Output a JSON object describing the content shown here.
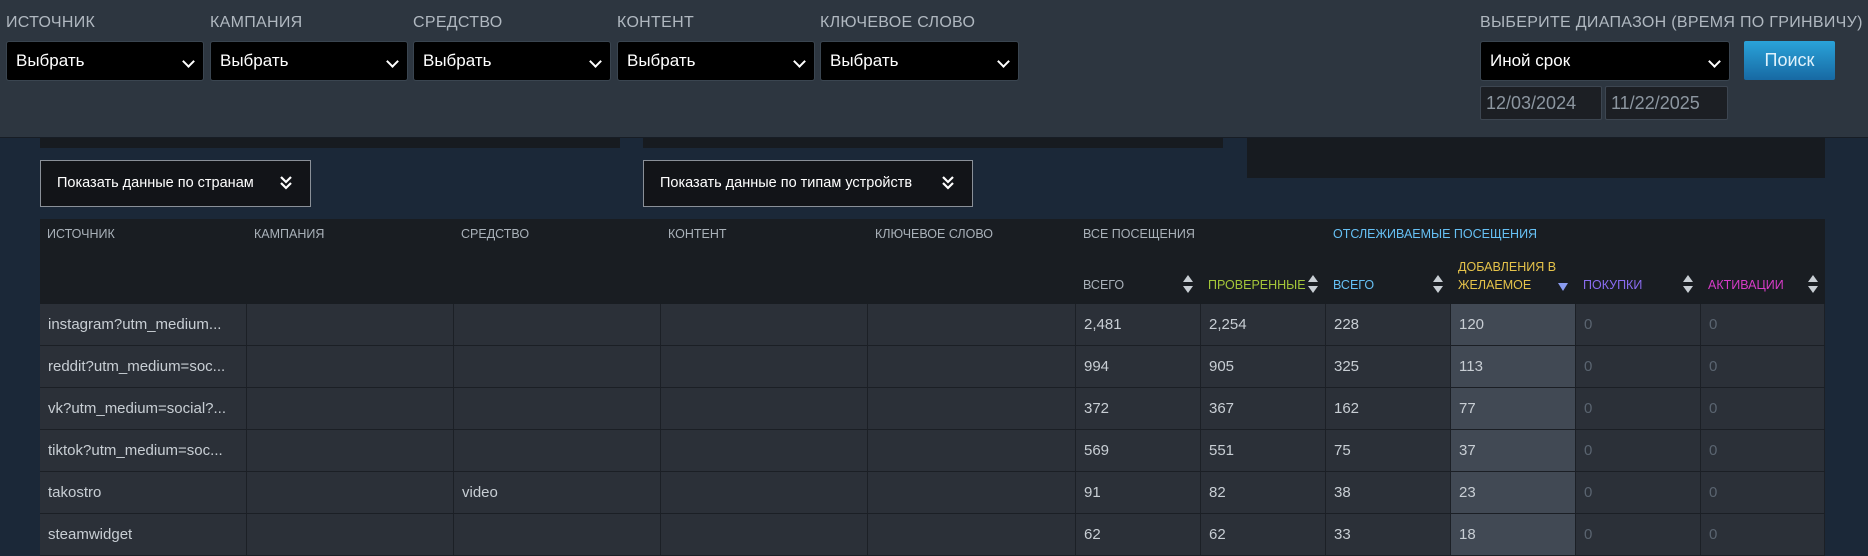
{
  "filters": [
    {
      "label": "ИСТОЧНИК",
      "value": "Выбрать"
    },
    {
      "label": "КАМПАНИЯ",
      "value": "Выбрать"
    },
    {
      "label": "СРЕДСТВО",
      "value": "Выбрать"
    },
    {
      "label": "КОНТЕНТ",
      "value": "Выбрать"
    },
    {
      "label": "КЛЮЧЕВОЕ СЛОВО",
      "value": "Выбрать"
    }
  ],
  "range": {
    "label": "ВЫБЕРИТЕ ДИАПАЗОН (ВРЕМЯ ПО ГРИНВИЧУ)",
    "value": "Иной срок",
    "start_date": "12/03/2024",
    "end_date": "11/22/2025",
    "search_label": "Поиск"
  },
  "toggles": {
    "countries": "Показать данные по странам",
    "devices": "Показать данные по типам устройств"
  },
  "table": {
    "headers": {
      "source": "ИСТОЧНИК",
      "campaign": "КАМПАНИЯ",
      "medium": "СРЕДСТВО",
      "content": "КОНТЕНТ",
      "keyword": "КЛЮЧЕВОЕ СЛОВО",
      "all_visits": "ВСЕ ПОСЕЩЕНИЯ",
      "tracked_visits": "ОТСЛЕЖИВАЕМЫЕ ПОСЕЩЕНИЯ",
      "total": "ВСЕГО",
      "verified": "ПРОВЕРЕННЫЕ",
      "tracked_total": "ВСЕГО",
      "wishlist_line1": "ДОБАВЛЕНИЯ В",
      "wishlist_line2": "ЖЕЛАЕМОЕ",
      "purchases": "ПОКУПКИ",
      "activations": "АКТИВАЦИИ"
    },
    "colors": {
      "verified": "#a4c639",
      "tracked": "#66c0f4",
      "wishlist": "#e5c34a",
      "purchases": "#8a6cf0",
      "activations": "#d63bc7"
    },
    "rows": [
      [
        "instagram?utm_medium...",
        "",
        "",
        "",
        "",
        "2,481",
        "2,254",
        "228",
        "120",
        "0",
        "0"
      ],
      [
        "reddit?utm_medium=soc...",
        "",
        "",
        "",
        "",
        "994",
        "905",
        "325",
        "113",
        "0",
        "0"
      ],
      [
        "vk?utm_medium=social?...",
        "",
        "",
        "",
        "",
        "372",
        "367",
        "162",
        "77",
        "0",
        "0"
      ],
      [
        "tiktok?utm_medium=soc...",
        "",
        "",
        "",
        "",
        "569",
        "551",
        "75",
        "37",
        "0",
        "0"
      ],
      [
        "takostro",
        "",
        "video",
        "",
        "",
        "91",
        "82",
        "38",
        "23",
        "0",
        "0"
      ],
      [
        "steamwidget",
        "",
        "",
        "",
        "",
        "62",
        "62",
        "33",
        "18",
        "0",
        "0"
      ]
    ]
  }
}
